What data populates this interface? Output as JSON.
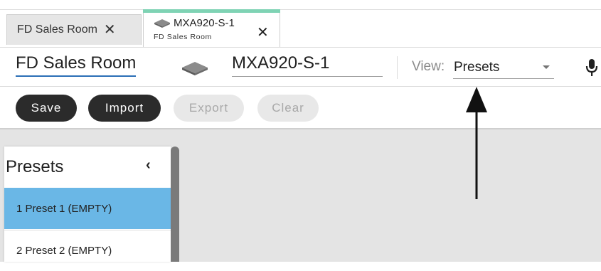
{
  "tabs": [
    {
      "label": "FD Sales Room",
      "close": "✕",
      "active": false
    },
    {
      "label": "MXA920-S-1",
      "subtitle": "FD Sales Room",
      "close": "✕",
      "active": true,
      "icon": "device-diamond-icon"
    }
  ],
  "colors": {
    "tab_accent": "#7fd3b4",
    "room_underline": "#2b6fb6",
    "dark_button": "#2b2b2b",
    "disabled_button": "#e8e8e8",
    "selected_item": "#6ab7e6",
    "content_bg": "#e4e4e4"
  },
  "header": {
    "room_name": "FD Sales Room",
    "device_icon": "device-diamond-icon",
    "device_name": "MXA920-S-1",
    "view_label": "View:",
    "view_value": "Presets",
    "mic_icon": "microphone-icon"
  },
  "toolbar": {
    "save_label": "Save",
    "import_label": "Import",
    "export_label": "Export",
    "clear_label": "Clear"
  },
  "presets_panel": {
    "title": "Presets",
    "collapse_glyph": "‹",
    "items": [
      {
        "label": "1 Preset 1 (EMPTY)",
        "selected": true
      },
      {
        "label": "2 Preset 2 (EMPTY)",
        "selected": false
      }
    ]
  },
  "annotation": {
    "icon": "arrow-up-icon"
  }
}
